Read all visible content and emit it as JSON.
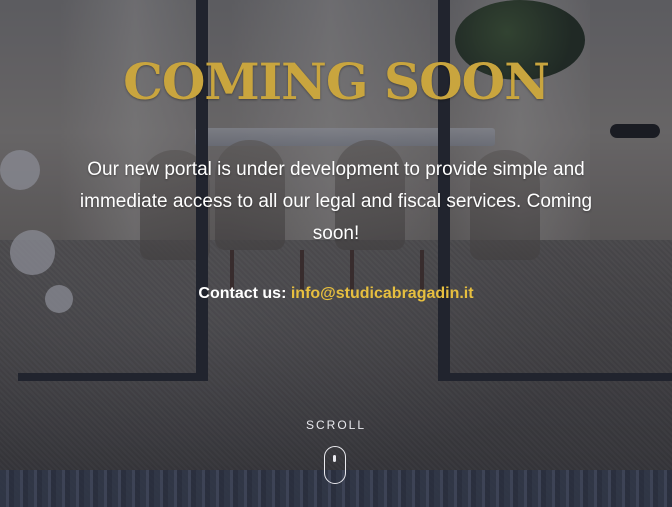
{
  "hero": {
    "title": "COMING SOON",
    "message": "Our new portal is under development to provide simple and immediate access to all our legal and fiscal services. Coming soon!",
    "contact_label": "Contact us:",
    "contact_email": "info@studicabragadin.it",
    "scroll_label": "SCROLL"
  },
  "colors": {
    "title": "#c9a53e",
    "email": "#e7bf3f",
    "text": "#ffffff",
    "overlay": "#262a38"
  },
  "icons": {
    "scroll": "mouse-icon"
  }
}
